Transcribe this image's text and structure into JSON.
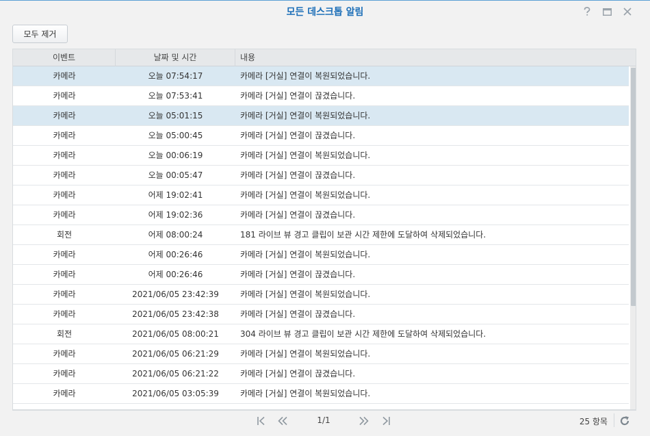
{
  "window": {
    "title": "모든 데스크톱 알림",
    "controls": {
      "help": "help-icon",
      "maximize": "maximize-icon",
      "close": "close-icon"
    }
  },
  "toolbar": {
    "clear_all_label": "모두 제거"
  },
  "table": {
    "columns": [
      "이벤트",
      "날짜 및 시간",
      "내용"
    ],
    "rows": [
      {
        "event": "카메라",
        "datetime": "오늘 07:54:17",
        "content": "카메라 [거실] 연결이 복원되었습니다.",
        "selected": true
      },
      {
        "event": "카메라",
        "datetime": "오늘 07:53:41",
        "content": "카메라 [거실] 연결이 끊겼습니다.",
        "selected": false
      },
      {
        "event": "카메라",
        "datetime": "오늘 05:01:15",
        "content": "카메라 [거실] 연결이 복원되었습니다.",
        "selected": true
      },
      {
        "event": "카메라",
        "datetime": "오늘 05:00:45",
        "content": "카메라 [거실] 연결이 끊겼습니다.",
        "selected": false
      },
      {
        "event": "카메라",
        "datetime": "오늘 00:06:19",
        "content": "카메라 [거실] 연결이 복원되었습니다.",
        "selected": false
      },
      {
        "event": "카메라",
        "datetime": "오늘 00:05:47",
        "content": "카메라 [거실] 연결이 끊겼습니다.",
        "selected": false
      },
      {
        "event": "카메라",
        "datetime": "어제 19:02:41",
        "content": "카메라 [거실] 연결이 복원되었습니다.",
        "selected": false
      },
      {
        "event": "카메라",
        "datetime": "어제 19:02:36",
        "content": "카메라 [거실] 연결이 끊겼습니다.",
        "selected": false
      },
      {
        "event": "회전",
        "datetime": "어제 08:00:24",
        "content": "181 라이브 뷰 경고 클립이 보관 시간 제한에 도달하여 삭제되었습니다.",
        "selected": false
      },
      {
        "event": "카메라",
        "datetime": "어제 00:26:46",
        "content": "카메라 [거실] 연결이 복원되었습니다.",
        "selected": false
      },
      {
        "event": "카메라",
        "datetime": "어제 00:26:46",
        "content": "카메라 [거실] 연결이 끊겼습니다.",
        "selected": false
      },
      {
        "event": "카메라",
        "datetime": "2021/06/05 23:42:39",
        "content": "카메라 [거실] 연결이 복원되었습니다.",
        "selected": false
      },
      {
        "event": "카메라",
        "datetime": "2021/06/05 23:42:38",
        "content": "카메라 [거실] 연결이 끊겼습니다.",
        "selected": false
      },
      {
        "event": "회전",
        "datetime": "2021/06/05 08:00:21",
        "content": "304 라이브 뷰 경고 클립이 보관 시간 제한에 도달하여 삭제되었습니다.",
        "selected": false
      },
      {
        "event": "카메라",
        "datetime": "2021/06/05 06:21:29",
        "content": "카메라 [거실] 연결이 복원되었습니다.",
        "selected": false
      },
      {
        "event": "카메라",
        "datetime": "2021/06/05 06:21:22",
        "content": "카메라 [거실] 연결이 끊겼습니다.",
        "selected": false
      },
      {
        "event": "카메라",
        "datetime": "2021/06/05 03:05:39",
        "content": "카메라 [거실] 연결이 복원되었습니다.",
        "selected": false
      }
    ]
  },
  "pager": {
    "page_info": "1/1",
    "item_count": "25 항목",
    "icons": [
      "first-page-icon",
      "previous-page-icon",
      "next-page-icon",
      "last-page-icon",
      "refresh-icon"
    ]
  },
  "colors": {
    "title": "#1d6fb8",
    "selected_row": "#d9e8f2",
    "header": "#e6e8ea"
  }
}
